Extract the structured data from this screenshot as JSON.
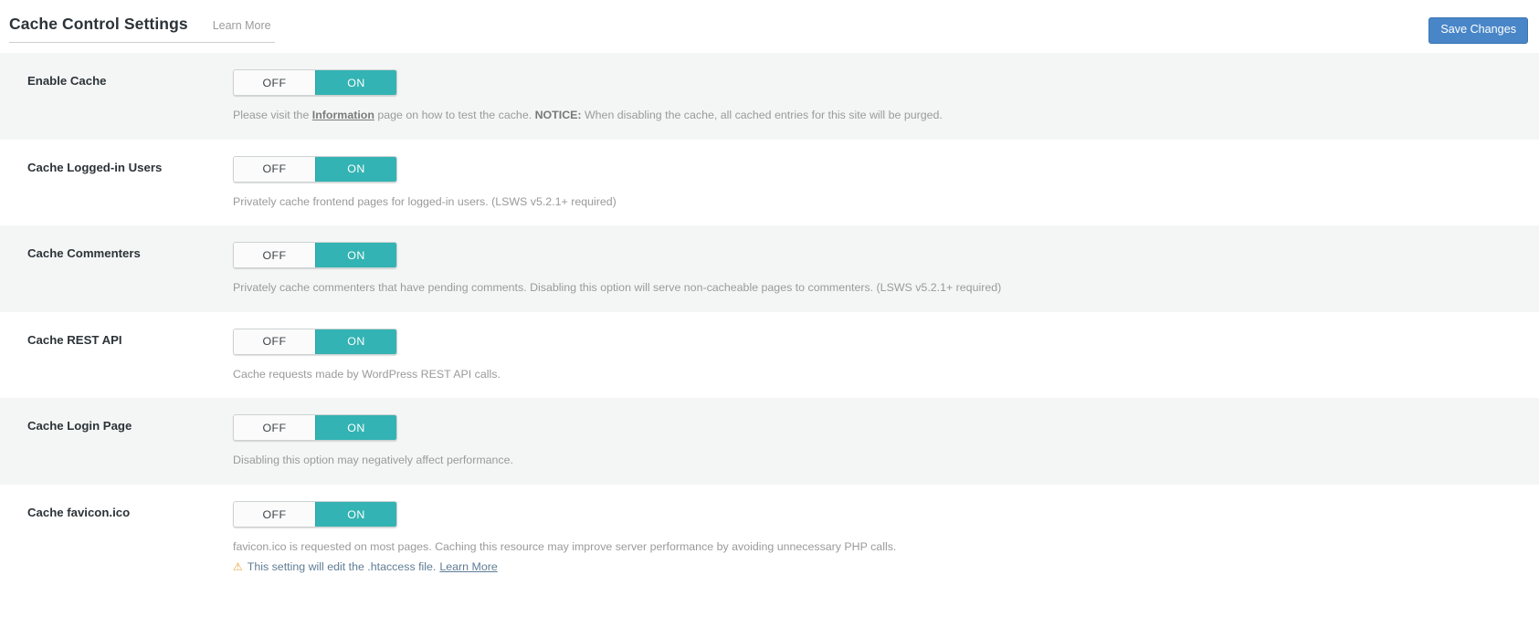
{
  "header": {
    "title": "Cache Control Settings",
    "learn_more_label": "Learn More",
    "save_label": "Save Changes",
    "save_color": "#4986c8"
  },
  "toggle": {
    "off_label": "OFF",
    "on_label": "ON",
    "active_color": "#33b3b3"
  },
  "settings": [
    {
      "label": "Enable Cache",
      "state": "ON",
      "desc_before_link": "Please visit the ",
      "desc_link": "Information",
      "desc_after_link": " page on how to test the cache. ",
      "desc_strong": "NOTICE:",
      "desc_tail": " When disabling the cache, all cached entries for this site will be purged."
    },
    {
      "label": "Cache Logged-in Users",
      "state": "ON",
      "desc": "Privately cache frontend pages for logged-in users. (LSWS v5.2.1+ required)"
    },
    {
      "label": "Cache Commenters",
      "state": "ON",
      "desc": "Privately cache commenters that have pending comments. Disabling this option will serve non-cacheable pages to commenters. (LSWS v5.2.1+ required)"
    },
    {
      "label": "Cache REST API",
      "state": "ON",
      "desc": "Cache requests made by WordPress REST API calls."
    },
    {
      "label": "Cache Login Page",
      "state": "ON",
      "desc": "Disabling this option may negatively affect performance."
    },
    {
      "label": "Cache favicon.ico",
      "state": "ON",
      "desc": "favicon.ico is requested on most pages. Caching this resource may improve server performance by avoiding unnecessary PHP calls.",
      "note_icon": "warning-triangle-icon",
      "note_text": "This setting will edit the .htaccess file.",
      "note_link": "Learn More"
    }
  ]
}
